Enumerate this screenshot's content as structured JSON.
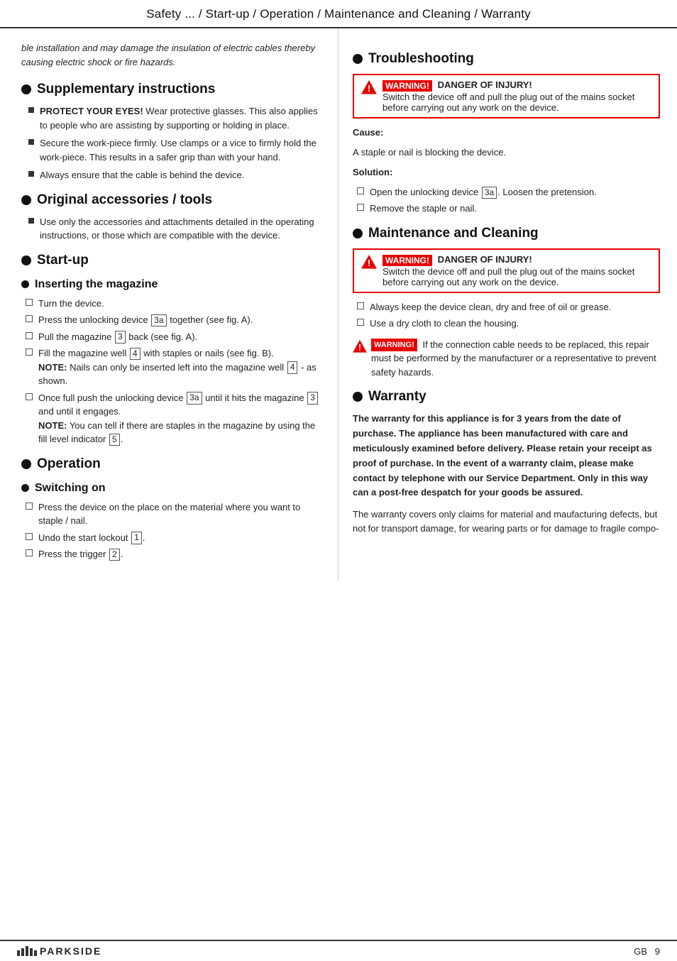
{
  "header": {
    "title": "Safety ... / Start-up / Operation / Maintenance and Cleaning / Warranty"
  },
  "left": {
    "intro_italic": "ble installation and may damage the insulation of electric cables thereby causing electric shock or fire hazards.",
    "supplementary": {
      "title": "Supplementary instructions",
      "items": [
        {
          "bold": "PROTECT YOUR EYES!",
          "text": " Wear protective glasses. This also applies to people who are assisting by supporting or holding in place."
        },
        {
          "bold": "",
          "text": "Secure the work-piece firmly. Use clamps or a vice to firmly hold the work-piece. This results in a safer grip than with your hand."
        },
        {
          "bold": "",
          "text": "Always ensure that the cable is behind the device."
        }
      ]
    },
    "original_accessories": {
      "title": "Original accessories / tools",
      "items": [
        {
          "text": "Use only the accessories and attachments detailed in the operating instructions, or those which are compatible with the device."
        }
      ]
    },
    "startup": {
      "title": "Start-up"
    },
    "inserting_magazine": {
      "title": "Inserting the magazine",
      "steps": [
        {
          "text": "Turn the device."
        },
        {
          "text": "Press the unlocking device ",
          "ref": "3a",
          "text2": " together (see fig. A)."
        },
        {
          "text": "Pull the magazine ",
          "ref": "3",
          "text2": " back (see fig. A)."
        },
        {
          "text": "Fill the magazine well ",
          "ref": "4",
          "text2": " with staples or nails (see fig. B)."
        },
        {
          "note": "NOTE:",
          "text": " Nails can only be inserted left into the magazine well ",
          "ref": "4",
          "text2": " - as shown."
        },
        {
          "text": "Once full push the unlocking device ",
          "ref": "3a",
          "text2": " until it hits the magazine ",
          "ref2": "3",
          "text3": " and until it engages."
        },
        {
          "note": "NOTE:",
          "text": " You can tell if there are staples in the magazine by using the fill level indicator ",
          "ref": "5",
          "text2": "."
        }
      ]
    },
    "operation": {
      "title": "Operation"
    },
    "switching_on": {
      "title": "Switching on",
      "steps": [
        {
          "text": "Press the device on the place on the material where you want to staple / nail."
        },
        {
          "text": "Undo the start lockout ",
          "ref": "1",
          "text2": "."
        },
        {
          "text": "Press the trigger ",
          "ref": "2",
          "text2": "."
        }
      ]
    }
  },
  "right": {
    "troubleshooting": {
      "title": "Troubleshooting",
      "warning_label": "WARNING!",
      "warning_text": "DANGER OF INJURY!",
      "warning_body": "Switch the device off and pull the plug out of the mains socket before carrying out any work on the device.",
      "cause_label": "Cause:",
      "cause_text": "A staple or nail is blocking the device.",
      "solution_label": "Solution:",
      "steps": [
        {
          "text": "Open the unlocking device ",
          "ref": "3a",
          "text2": ". Loosen the pretension."
        },
        {
          "text": "Remove the staple or nail."
        }
      ]
    },
    "maintenance": {
      "title": "Maintenance and Cleaning",
      "warning_label": "WARNING!",
      "warning_text": "DANGER OF INJURY!",
      "warning_body": "Switch the device off and pull the plug out of the mains socket before carrying out any work on the device.",
      "steps": [
        {
          "text": "Always keep the device clean, dry and free of oil or grease."
        },
        {
          "text": "Use a dry cloth to clean the housing."
        }
      ],
      "warning2_label": "WARNING!",
      "warning2_text": "If the connection cable needs to be replaced, this repair must be performed by the manufacturer or a representative to prevent safety hazards."
    },
    "warranty": {
      "title": "Warranty",
      "bold_text": "The warranty for this appliance is for 3 years from the date of purchase. The appliance has been manufactured with care and meticulously examined before delivery. Please retain your receipt as proof of purchase. In the event of a warranty claim, please make contact by telephone with our Service Department. Only in this way can a post-free despatch for your goods be assured.",
      "body_text": "The warranty covers only claims for material and maufacturing defects, but not for transport damage, for wearing parts or for damage to fragile compo-"
    }
  },
  "footer": {
    "logo": "PARKSIDE",
    "country": "GB",
    "page": "9"
  }
}
